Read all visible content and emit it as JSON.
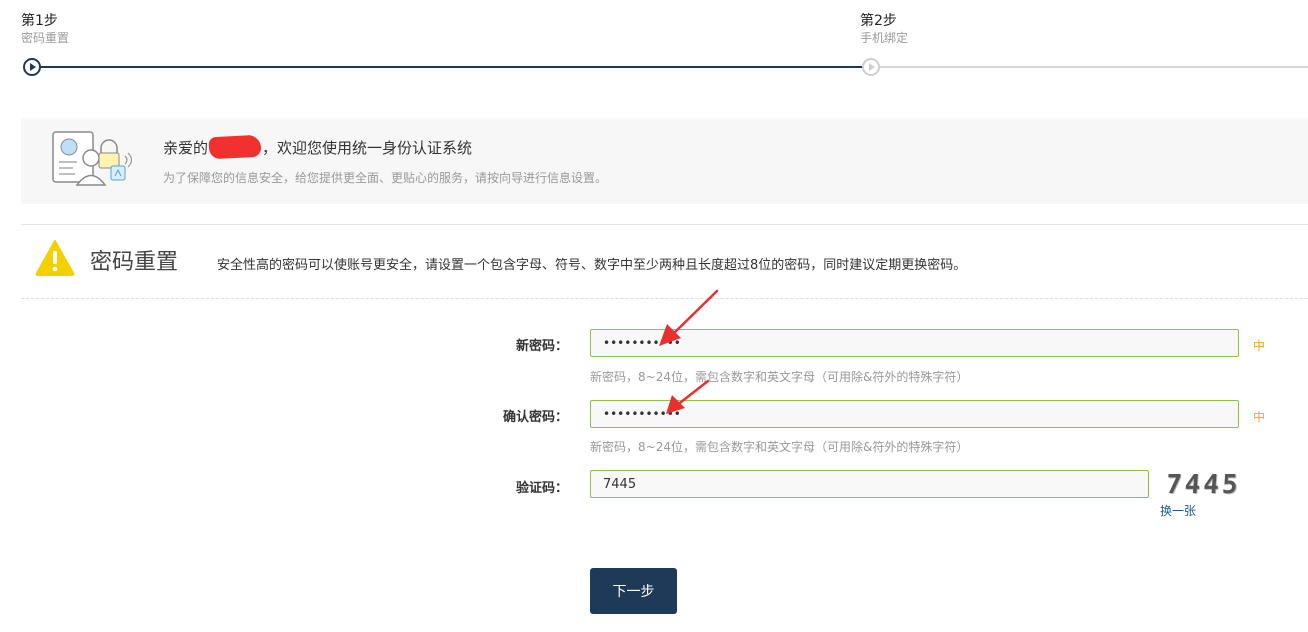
{
  "stepper": {
    "steps": [
      {
        "title": "第1步",
        "subtitle": "密码重置",
        "state": "active"
      },
      {
        "title": "第2步",
        "subtitle": "手机绑定",
        "state": "pending"
      }
    ],
    "colors": {
      "active": "#1f3a58",
      "inactive": "#d6d6d6"
    }
  },
  "banner": {
    "greeting_prefix": "亲爱的",
    "greeting_suffix": "，欢迎您使用统一身份认证系统",
    "description": "为了保障您的信息安全，给您提供更全面、更贴心的服务，请按向导进行信息设置。",
    "illustration_icon": "identity-card-illustration-icon"
  },
  "section": {
    "title": "密码重置",
    "description": "安全性高的密码可以使账号更安全，请设置一个包含字母、符号、数字中至少两种且长度超过8位的密码，同时建议定期更换密码。",
    "icon": "warning-icon"
  },
  "form": {
    "new_password": {
      "label": "新密码：",
      "value": "•••••••••••",
      "strength": "中",
      "hint": "新密码，8~24位，需包含数字和英文字母（可用除&符外的特殊字符）"
    },
    "confirm_password": {
      "label": "确认密码：",
      "value": "•••••••••••",
      "strength": "中",
      "hint": "新密码，8~24位，需包含数字和英文字母（可用除&符外的特殊字符）"
    },
    "captcha": {
      "label": "验证码：",
      "value": "7445",
      "image_text": "7445",
      "refresh_label": "换一张"
    },
    "next_button": "下一步"
  },
  "colors": {
    "primary": "#1f3a58",
    "input_border": "#8bc34a",
    "strength_medium": "#f0a030",
    "annotation_arrow": "#e8302e",
    "warning": "#f5d000"
  }
}
